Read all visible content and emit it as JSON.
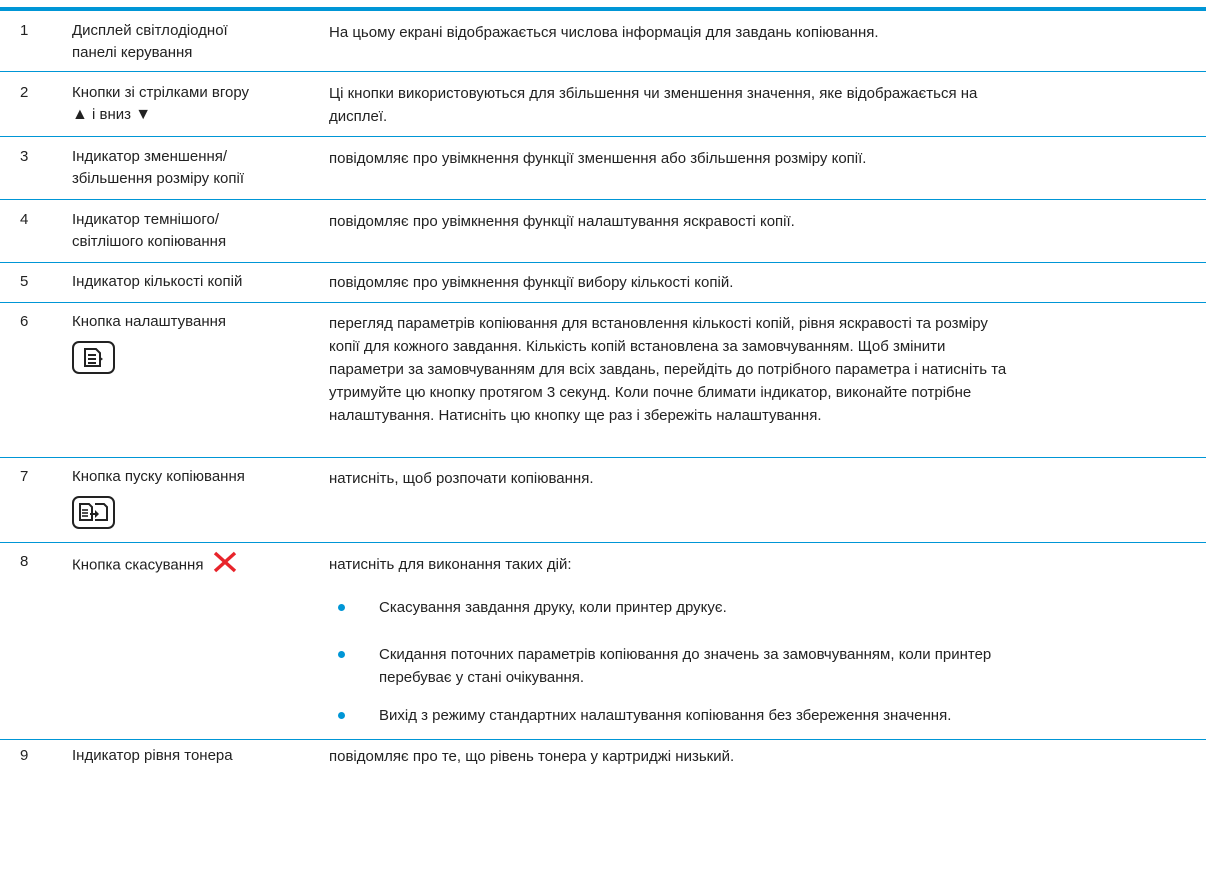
{
  "rows": [
    {
      "num": "1",
      "name_lines": [
        "Дисплей світлодіодної",
        "панелі керування"
      ],
      "desc": "На цьому екрані відображається числова інформація для завдань копіювання."
    },
    {
      "num": "2",
      "name_line1": "Кнопки зі стрілками вгору",
      "name_line2_pre": "і вниз",
      "arrow_up": "▲",
      "arrow_down": "▼",
      "desc_lines": [
        "Ці кнопки використовуються для збільшення чи зменшення значення, яке відображається на",
        "дисплеї."
      ]
    },
    {
      "num": "3",
      "name_lines": [
        "Індикатор зменшення/",
        "збільшення розміру копії"
      ],
      "desc": "повідомляє про увімкнення функції зменшення або збільшення розміру копії."
    },
    {
      "num": "4",
      "name_lines": [
        "Індикатор темнішого/",
        "світлішого копіювання"
      ],
      "desc": "повідомляє про увімкнення функції налаштування яскравості копії."
    },
    {
      "num": "5",
      "name": "Індикатор кількості копій",
      "desc": "повідомляє про увімкнення функції вибору кількості копій."
    },
    {
      "num": "6",
      "name": "Кнопка налаштування",
      "icon": "setup-icon",
      "desc_lines": [
        "перегляд параметрів копіювання для встановлення кількості копій, рівня яскравості та розміру",
        "копії для кожного завдання. Кількість копій встановлена за замовчуванням. Щоб змінити",
        "параметри за замовчуванням для всіх завдань, перейдіть до потрібного параметра і натисніть та",
        "утримуйте цю кнопку протягом 3 секунд. Коли почне блимати індикатор, виконайте потрібне",
        "налаштування. Натисніть цю кнопку ще раз і збережіть налаштування."
      ]
    },
    {
      "num": "7",
      "name": "Кнопка пуску копіювання",
      "icon": "start-copy-icon",
      "desc": "натисніть, щоб розпочати копіювання."
    },
    {
      "num": "8",
      "name": "Кнопка скасування",
      "icon": "cancel-x-icon",
      "desc": "натисніть для виконання таких дій:",
      "bullets": [
        {
          "lines": [
            "Скасування завдання друку, коли принтер друкує."
          ]
        },
        {
          "lines": [
            "Скидання поточних параметрів копіювання до значень за замовчуванням, коли принтер",
            "перебуває у стані очікування."
          ]
        },
        {
          "lines": [
            "Вихід з режиму стандартних налаштування копіювання без збереження значення."
          ]
        }
      ]
    },
    {
      "num": "9",
      "name": "Індикатор рівня тонера",
      "desc": "повідомляє про те, що рівень тонера у картриджі низький."
    }
  ],
  "colors": {
    "accent": "#0096d6",
    "cancel": "#e8242b"
  }
}
